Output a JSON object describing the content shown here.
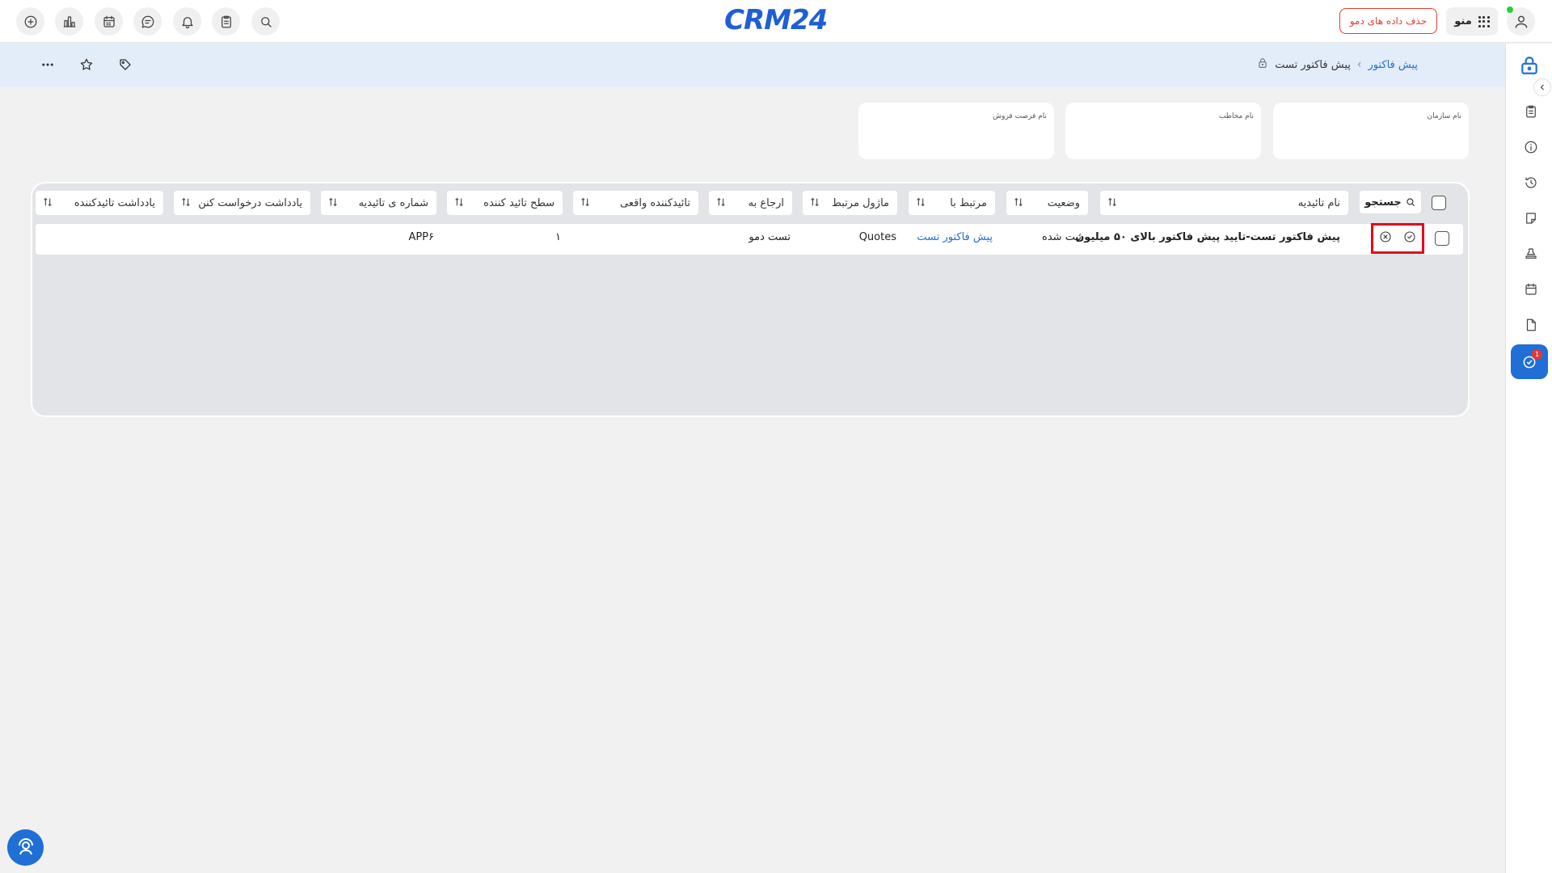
{
  "header": {
    "logo": "CRM24",
    "demo_button": "حذف داده های دمو",
    "menu_label": "منو",
    "left_icons": [
      "add-icon",
      "chart-icon",
      "calendar-icon",
      "chat-icon",
      "bell-icon",
      "clipboard-icon",
      "search-icon"
    ]
  },
  "breadcrumb": {
    "root": "پیش فاکتور",
    "separator": "›",
    "current": "پیش فاکتور تست"
  },
  "cards": [
    {
      "label": "نام سازمان"
    },
    {
      "label": "نام مخاطب"
    },
    {
      "label": "نام فرصت فروش"
    }
  ],
  "table": {
    "search_label": "جستجو",
    "headers": [
      "نام تائیدیه",
      "وضعیت",
      "مرتبط با",
      "ماژول مرتبط",
      "ارجاع به",
      "تائیدکننده واقعی",
      "سطح تائید کننده",
      "شماره ی تائیدیه",
      "یادداشت درخواست کنن",
      "یادداشت تائیدکننده"
    ],
    "rows": [
      {
        "name": "پیش فاکتور تست-تایید پیش فاکتور بالای ۵۰ میلیون",
        "status": "ثبت شده",
        "related_to": "پیش فاکتور تست",
        "module": "Quotes",
        "assigned_to": "تست دمو",
        "actual_approver": "",
        "level": "۱",
        "number": "APP۶",
        "requester_note": "",
        "approver_note": ""
      }
    ]
  },
  "sidebar": {
    "badge_count": "1",
    "items": [
      "clipboard-icon",
      "info-icon",
      "history-icon",
      "note-icon",
      "stamp-icon",
      "calendar-icon",
      "document-icon",
      "approval-icon"
    ]
  },
  "colors": {
    "accent": "#1f6fd6",
    "danger": "#e53935",
    "subbar": "#e3edf9"
  }
}
